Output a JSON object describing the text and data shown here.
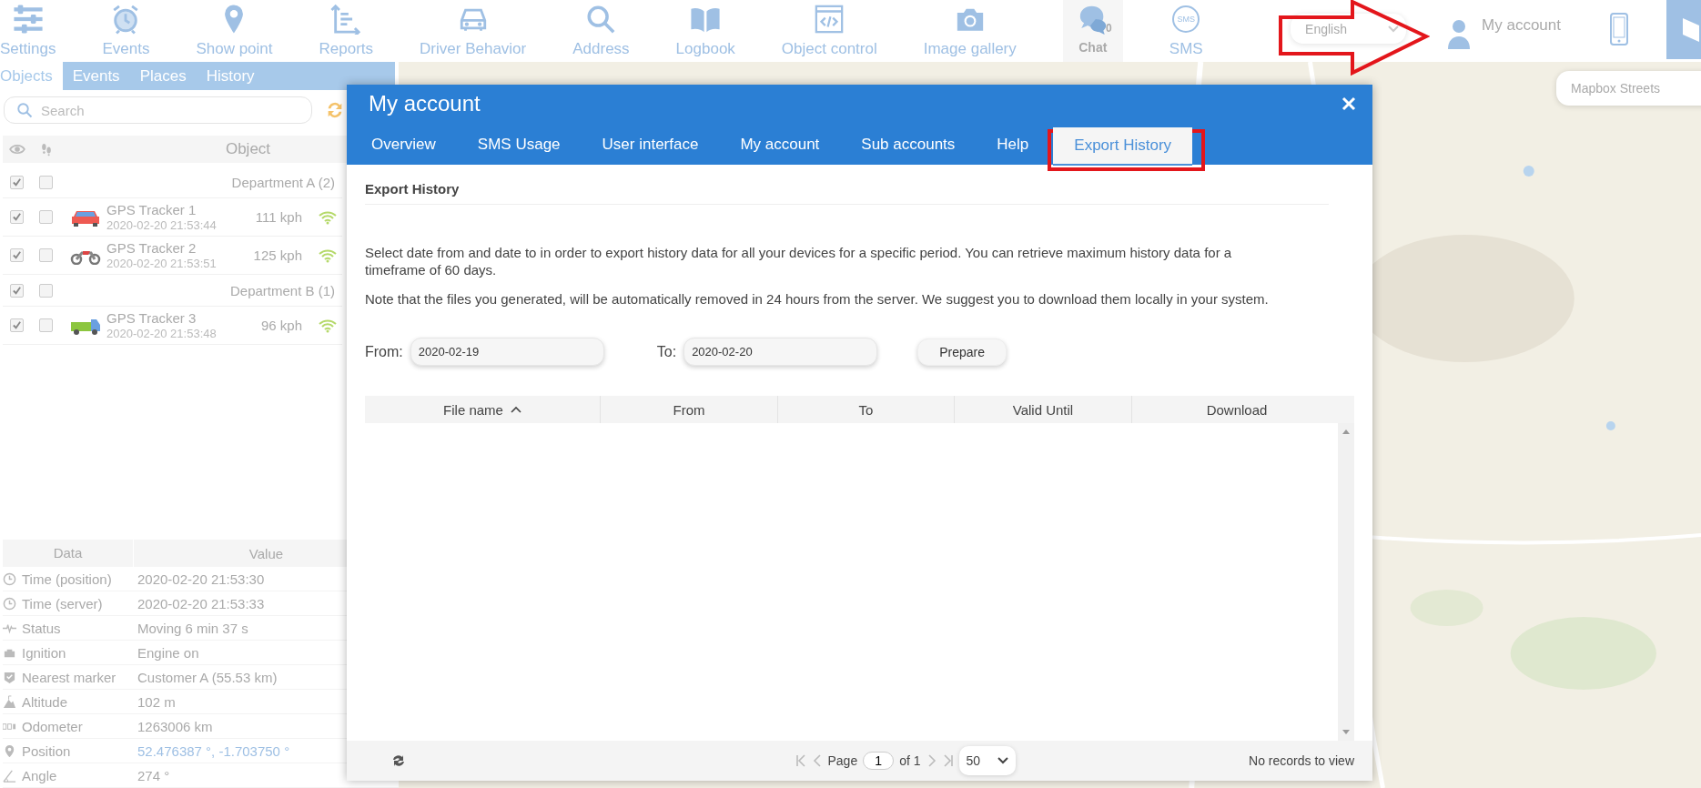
{
  "toolbar": {
    "items": [
      {
        "label": "Settings"
      },
      {
        "label": "Events"
      },
      {
        "label": "Show point"
      },
      {
        "label": "Reports"
      },
      {
        "label": "Driver Behavior"
      },
      {
        "label": "Address"
      },
      {
        "label": "Logbook"
      },
      {
        "label": "Object control"
      },
      {
        "label": "Image gallery"
      },
      {
        "label": "Chat",
        "badge": "0"
      },
      {
        "label": "SMS",
        "icon_text": "SMS"
      }
    ],
    "language": {
      "value": "English"
    },
    "account": {
      "label": "My account"
    }
  },
  "left_panel": {
    "tabs": [
      {
        "label": "Objects",
        "selected": true
      },
      {
        "label": "Events",
        "selected": false
      },
      {
        "label": "Places",
        "selected": false
      },
      {
        "label": "History",
        "selected": false
      }
    ],
    "search": {
      "placeholder": "Search"
    },
    "objects": {
      "column": "Object",
      "rows": [
        {
          "kind": "group",
          "name": "Department A (2)",
          "visible": true,
          "follow": false
        },
        {
          "kind": "object",
          "name": "GPS Tracker 1",
          "time": "2020-02-20 21:53:44",
          "speed": "111 kph",
          "visible": true,
          "follow": false
        },
        {
          "kind": "object",
          "name": "GPS Tracker 2",
          "time": "2020-02-20 21:53:51",
          "speed": "125 kph",
          "visible": true,
          "follow": false
        },
        {
          "kind": "group",
          "name": "Department B (1)",
          "visible": true,
          "follow": false
        },
        {
          "kind": "object",
          "name": "GPS Tracker 3",
          "time": "2020-02-20 21:53:48",
          "speed": "96 kph",
          "visible": true,
          "follow": false
        }
      ]
    },
    "data": {
      "columns": [
        "Data",
        "Value"
      ],
      "rows": [
        {
          "label": "Time (position)",
          "value": "2020-02-20 21:53:30",
          "link": false
        },
        {
          "label": "Time (server)",
          "value": "2020-02-20 21:53:33",
          "link": false
        },
        {
          "label": "Status",
          "value": "Moving 6 min 37 s",
          "link": false
        },
        {
          "label": "Ignition",
          "value": "Engine on",
          "link": false
        },
        {
          "label": "Nearest marker",
          "value": "Customer A (55.53 km)",
          "link": false
        },
        {
          "label": "Altitude",
          "value": "102 m",
          "link": false
        },
        {
          "label": "Odometer",
          "value": "1263006 km",
          "link": false
        },
        {
          "label": "Position",
          "value": "52.476387 °, -1.703750 °",
          "link": true
        },
        {
          "label": "Angle",
          "value": "274 °",
          "link": false
        }
      ]
    }
  },
  "map": {
    "layer": "Mapbox Streets"
  },
  "dialog": {
    "title": "My account",
    "tabs": [
      {
        "label": "Overview",
        "selected": false
      },
      {
        "label": "SMS Usage",
        "selected": false
      },
      {
        "label": "User interface",
        "selected": false
      },
      {
        "label": "My account",
        "selected": false
      },
      {
        "label": "Sub accounts",
        "selected": false
      },
      {
        "label": "Help",
        "selected": false
      },
      {
        "label": "Export History",
        "selected": true,
        "highlighted": true
      }
    ],
    "section_title": "Export History",
    "paragraphs": [
      "Select date from and date to in order to export history data for all your devices for a specific period. You can retrieve maximum history data for a timeframe of 60 days.",
      "Note that the files you generated, will be automatically removed in 24 hours from the server. We suggest you to download them locally in your system."
    ],
    "form": {
      "from_label": "From:",
      "from_value": "2020-02-19",
      "to_label": "To:",
      "to_value": "2020-02-20",
      "button": "Prepare"
    },
    "grid": {
      "columns": [
        {
          "label": "File name",
          "sorted": true
        },
        {
          "label": "From",
          "sorted": false
        },
        {
          "label": "To",
          "sorted": false
        },
        {
          "label": "Valid Until",
          "sorted": false
        },
        {
          "label": "Download",
          "sorted": false
        }
      ]
    },
    "pager": {
      "page_label": "Page",
      "page": "1",
      "of": "of 1",
      "per_page": "50",
      "status": "No records to view"
    }
  }
}
